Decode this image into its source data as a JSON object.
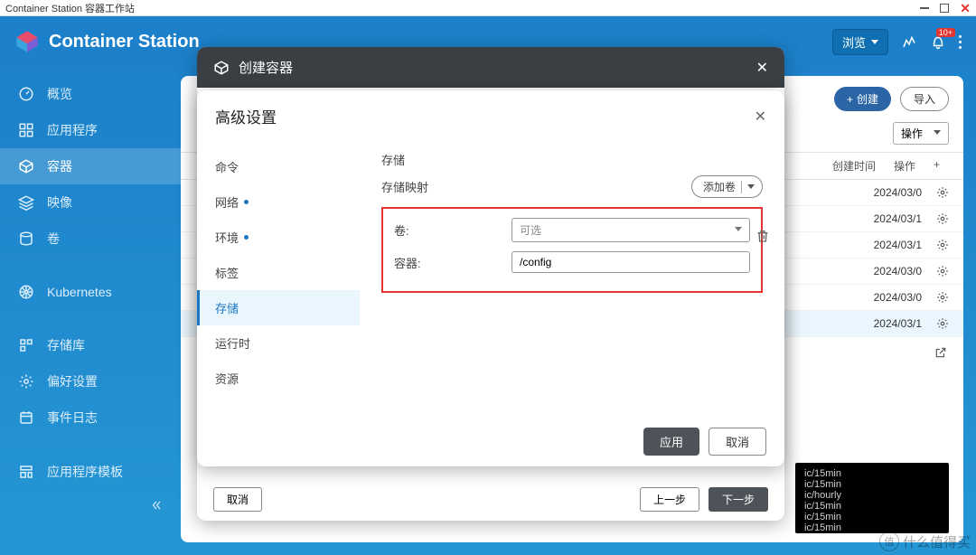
{
  "window": {
    "title": "Container Station 容器工作站"
  },
  "topbar": {
    "app_title": "Container Station",
    "browse": "浏览",
    "notif_badge": "10+"
  },
  "sidebar": {
    "items": [
      {
        "label": "概览"
      },
      {
        "label": "应用程序"
      },
      {
        "label": "容器"
      },
      {
        "label": "映像"
      },
      {
        "label": "卷"
      },
      {
        "label": "Kubernetes"
      },
      {
        "label": "存储库"
      },
      {
        "label": "偏好设置"
      },
      {
        "label": "事件日志"
      },
      {
        "label": "应用程序模板"
      }
    ]
  },
  "content": {
    "create_btn": "创建",
    "import_btn": "导入",
    "ops_label": "操作",
    "cols": {
      "created": "创建时间",
      "ops": "操作"
    },
    "rows": [
      {
        "date": "2024/03/0"
      },
      {
        "date": "2024/03/1"
      },
      {
        "date": "2024/03/1"
      },
      {
        "date": "2024/03/0"
      },
      {
        "date": "2024/03/0"
      },
      {
        "date": "2024/03/1"
      }
    ]
  },
  "console": {
    "lines": [
      "ic/15min",
      "ic/15min",
      "ic/hourly",
      "ic/15min",
      "ic/15min",
      "ic/15min"
    ]
  },
  "modal1": {
    "title": "创建容器",
    "cancel": "取消",
    "prev": "上一步",
    "next": "下一步"
  },
  "modal2": {
    "title": "高级设置",
    "tabs": {
      "command": "命令",
      "network": "网络",
      "env": "环境",
      "labels": "标签",
      "storage": "存储",
      "runtime": "运行时",
      "resources": "资源"
    },
    "panel": {
      "heading": "存储",
      "map_heading": "存储映射",
      "add_vol": "添加卷",
      "form": {
        "vol_label": "卷:",
        "vol_placeholder": "可选",
        "container_label": "容器:",
        "container_value": "/config"
      }
    },
    "apply": "应用",
    "cancel": "取消"
  },
  "watermark": {
    "circle": "值",
    "text": "什么值得买"
  }
}
